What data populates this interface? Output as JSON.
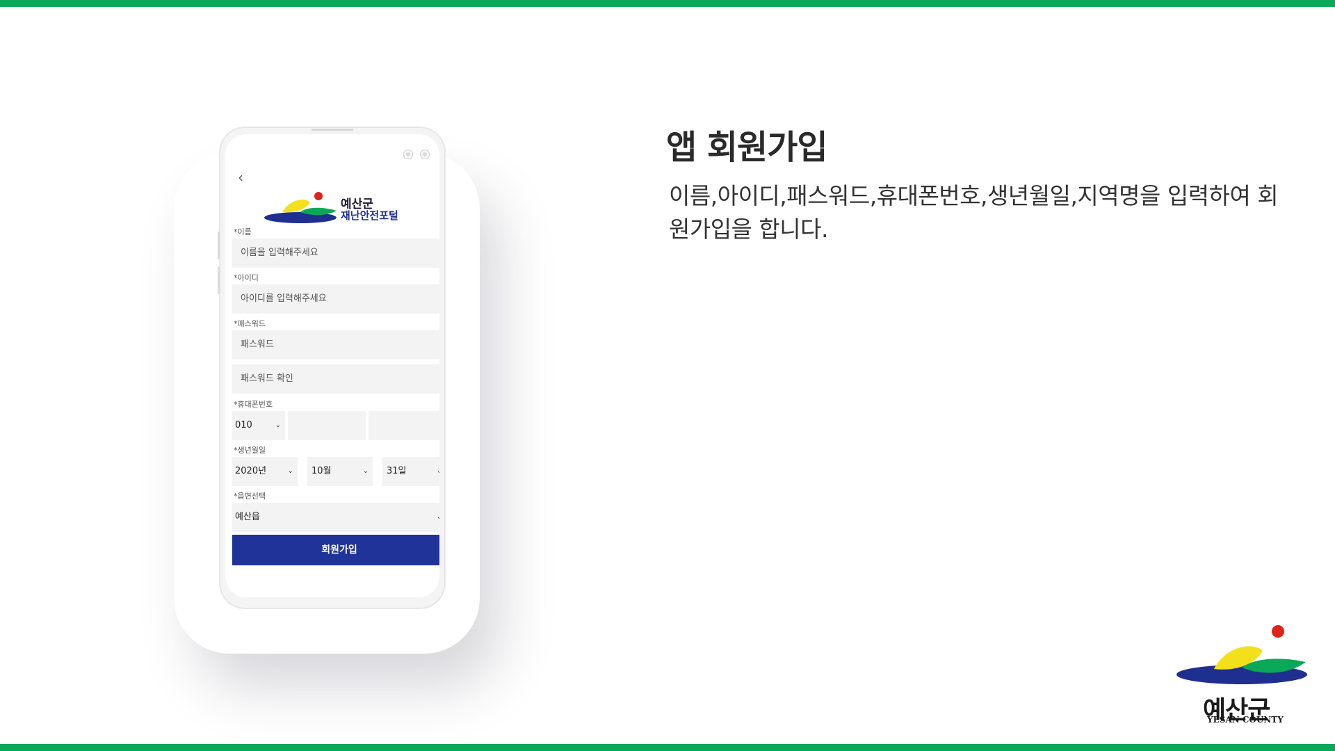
{
  "colors": {
    "accent_green": "#0aa858",
    "brand_blue": "#1f3399",
    "brand_yellow": "#f2e11a",
    "brand_red": "#e0231b"
  },
  "phone": {
    "back_icon": "chevron-left-icon",
    "logo": {
      "name": "예산군",
      "subtitle": "재난안전포털"
    },
    "form": {
      "name_label": "*이름",
      "name_placeholder": "이름을 입력해주세요",
      "id_label": "*아이디",
      "id_placeholder": "아이디를 입력해주세요",
      "password_label": "*패스워드",
      "password_placeholder": "패스워드",
      "password_confirm_placeholder": "패스워드 확인",
      "phone_label": "*휴대폰번호",
      "phone_prefix": "010",
      "birth_label": "*생년월일",
      "birth_year": "2020년",
      "birth_month": "10월",
      "birth_day": "31일",
      "region_label": "*읍면선택",
      "region_value": "예산읍",
      "submit_label": "회원가입"
    }
  },
  "content": {
    "title": "앱 회원가입",
    "description": "이름,아이디,패스워드,휴대폰번호,생년월일,지역명을 입력하여 회원가입을 합니다."
  },
  "brand": {
    "name": "예산군",
    "subtitle": "YESAN COUNTY"
  }
}
